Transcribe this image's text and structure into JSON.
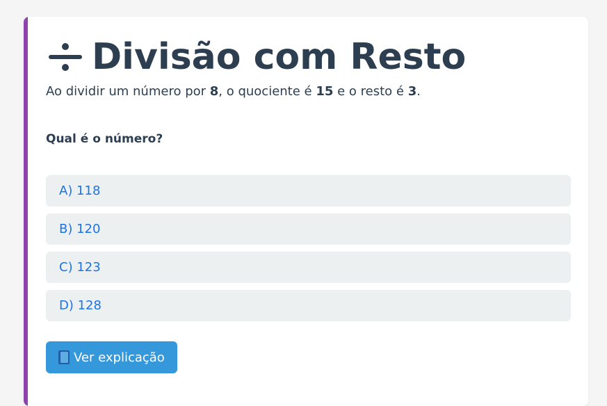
{
  "title": {
    "icon": "division-icon",
    "text": "Divisão com Resto"
  },
  "statement": {
    "prefix": "Ao dividir um número por ",
    "divisor": "8",
    "middle1": ", o quociente é ",
    "quotient": "15",
    "middle2": " e o resto é ",
    "remainder": "3",
    "suffix": "."
  },
  "question": "Qual é o número?",
  "options": [
    {
      "label": "A) 118"
    },
    {
      "label": "B) 120"
    },
    {
      "label": "C) 123"
    },
    {
      "label": "D) 128"
    }
  ],
  "explain_button": {
    "icon": "book-icon",
    "label": "Ver explicação"
  },
  "colors": {
    "accent": "#8e44ad",
    "title": "#2c3e50",
    "option_text": "#1a73e8",
    "option_bg": "#ecf0f1",
    "button_bg": "#3498db"
  }
}
